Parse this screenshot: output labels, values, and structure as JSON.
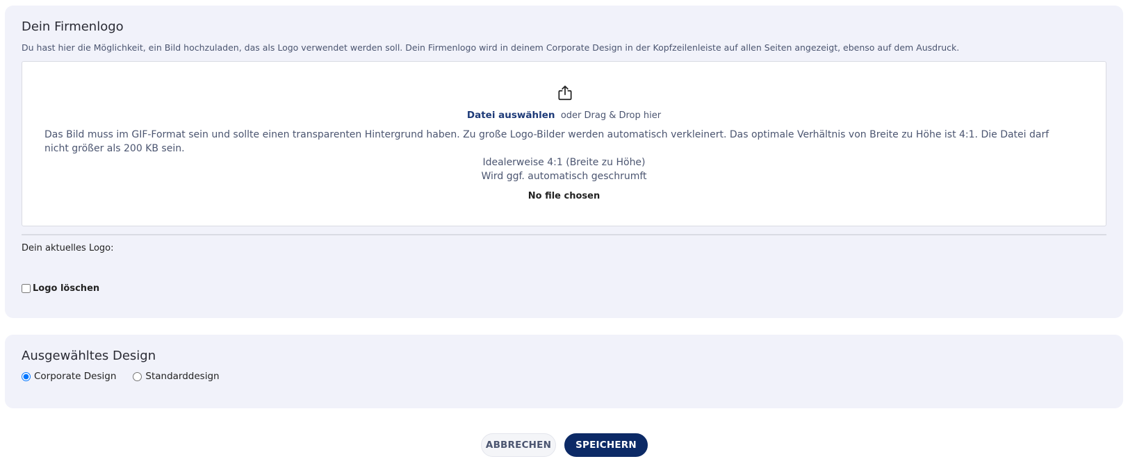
{
  "logo_section": {
    "title": "Dein Firmenlogo",
    "description": "Du hast hier die Möglichkeit, ein Bild hochzuladen, das als Logo verwendet werden soll. Dein Firmenlogo wird in deinem Corporate Design in der Kopfzeilenleiste auf allen Seiten angezeigt, ebenso auf dem Ausdruck.",
    "upload_icon": "upload-icon",
    "choose_file_label": "Datei auswählen",
    "drag_drop_text": "oder Drag & Drop hier",
    "requirements": "Das Bild muss im GIF-Format sein und sollte einen transparenten Hintergrund haben. Zu große Logo-Bilder werden automatisch verkleinert. Das optimale Verhältnis von Breite zu Höhe ist 4:1. Die Datei darf nicht größer als 200 KB sein.",
    "ideal_ratio": "Idealerweise 4:1 (Breite zu Höhe)",
    "auto_shrink": "Wird ggf. automatisch geschrumft",
    "file_status": "No file chosen",
    "current_logo_label": "Dein aktuelles Logo:",
    "delete_logo_label": "Logo löschen",
    "delete_logo_checked": false
  },
  "design_section": {
    "title": "Ausgewähltes Design",
    "options": [
      {
        "label": "Corporate Design",
        "selected": true
      },
      {
        "label": "Standarddesign",
        "selected": false
      }
    ]
  },
  "actions": {
    "cancel_label": "ABBRECHEN",
    "save_label": "SPEICHERN"
  },
  "colors": {
    "card_background": "#f1f2fa",
    "primary": "#0c2a66",
    "link": "#1d3a78",
    "muted_text": "#4b5570"
  }
}
